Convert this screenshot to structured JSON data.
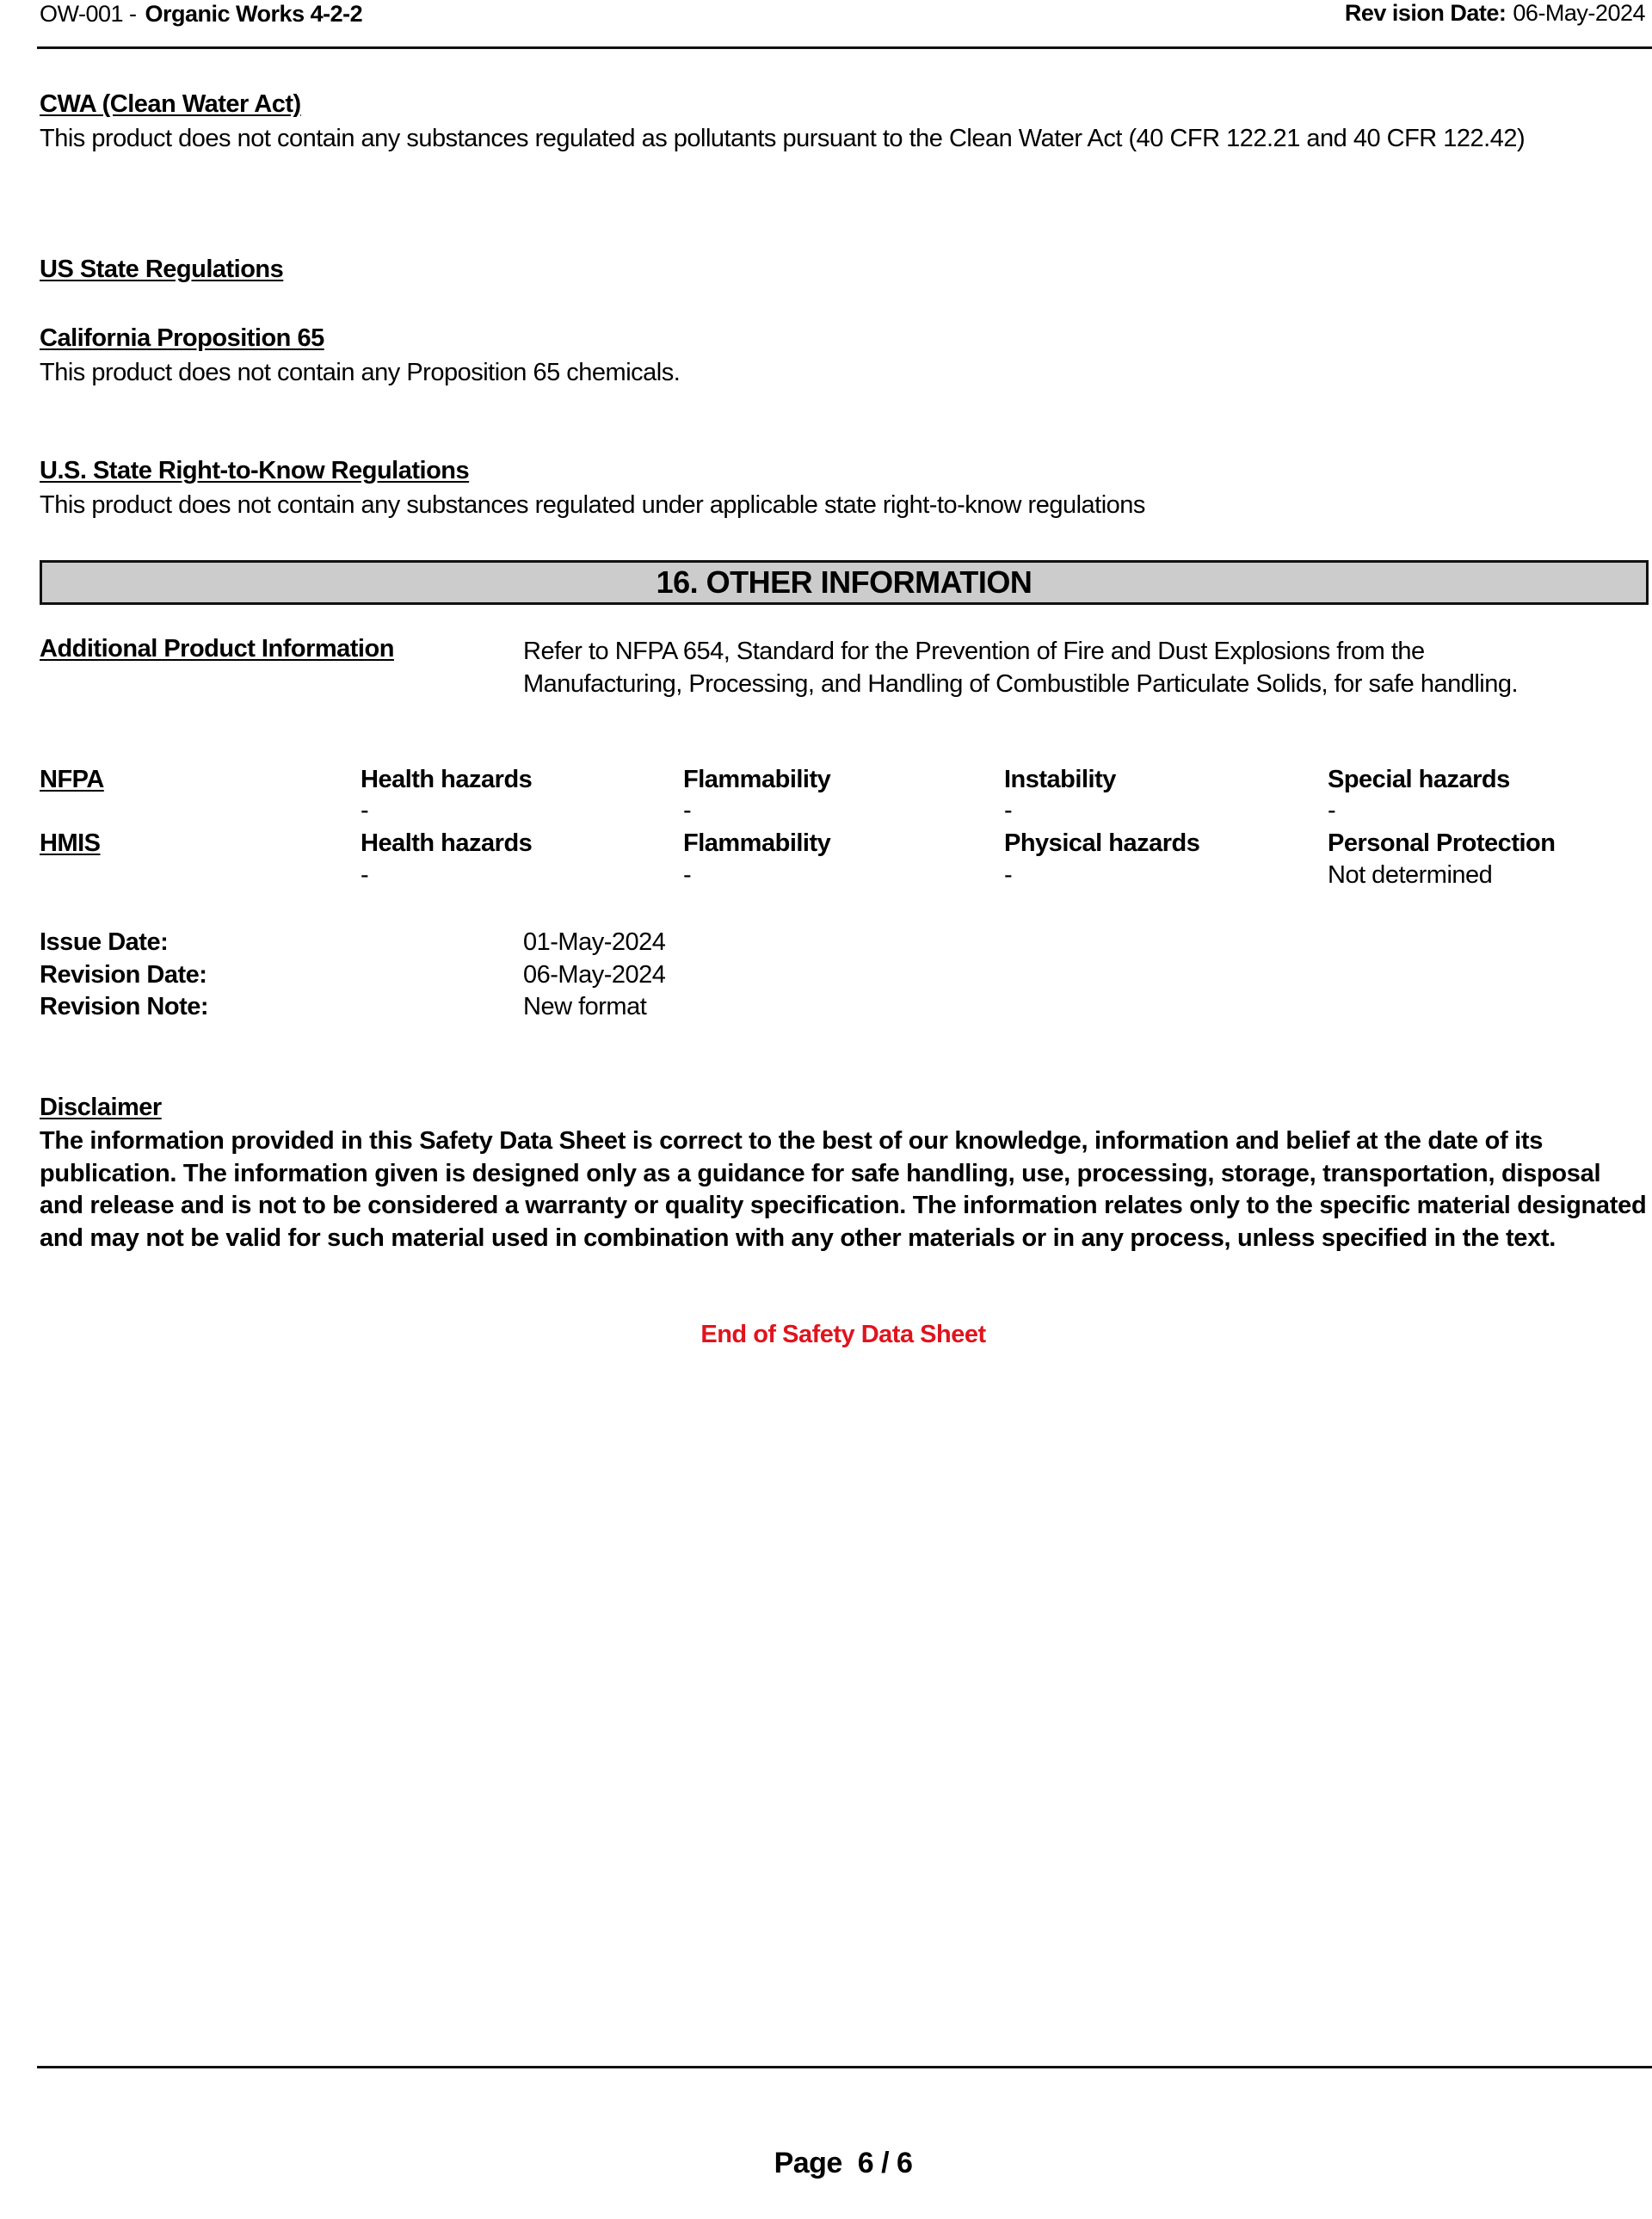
{
  "header": {
    "doc_code": "OW-001 -",
    "product_name": "Organic Works 4-2-2",
    "revision_label": "Rev ision Date:",
    "revision_value": "06-May-2024"
  },
  "regulations": {
    "cwa": {
      "heading": "CWA (Clean Water Act)",
      "text": "This product does not contain any substances regulated as pollutants pursuant to the Clean Water Act (40 CFR 122.21 and 40 CFR 122.42)"
    },
    "us_state": {
      "heading": "US State Regulations"
    },
    "prop65": {
      "heading": "California Proposition 65",
      "text": "This product does not contain any Proposition 65 chemicals."
    },
    "right_to_know": {
      "heading": "U.S. State Right-to-Know Regulations",
      "text": "This product does not contain any substances regulated under applicable state right-to-know regulations"
    }
  },
  "section16": {
    "title": "16. OTHER INFORMATION",
    "additional_info": {
      "label": "Additional Product Information",
      "text": "Refer to NFPA 654, Standard for the Prevention of Fire and Dust Explosions from the Manufacturing, Processing, and Handling of Combustible Particulate Solids, for safe handling."
    },
    "nfpa": {
      "label": "NFPA",
      "columns": [
        "Health hazards",
        "Flammability",
        "Instability",
        "Special hazards"
      ],
      "values": [
        "-",
        "-",
        "-",
        "-"
      ]
    },
    "hmis": {
      "label": "HMIS",
      "columns": [
        "Health hazards",
        "Flammability",
        "Physical hazards",
        "Personal Protection"
      ],
      "values": [
        "-",
        "-",
        "-",
        "Not determined"
      ]
    },
    "dates": [
      {
        "label": "Issue Date:",
        "value": "01-May-2024"
      },
      {
        "label": "Revision Date:",
        "value": "06-May-2024"
      },
      {
        "label": "Revision Note:",
        "value": "New format"
      }
    ],
    "disclaimer": {
      "heading": "Disclaimer",
      "text": "The information provided in this Safety Data Sheet is correct to the best of our knowledge, information and belief at the date of its publication. The information given is designed only as a guidance for safe handling, use, processing, storage, transportation, disposal and release and is not to be considered a warranty or quality specification. The information relates only to the specific material designated and may not be valid for such material used in combination with any other materials or in any process, unless specified in the text."
    },
    "end_text": "End of Safety Data Sheet"
  },
  "footer": {
    "page_label": "Page  6 / 6"
  },
  "colors": {
    "section_fill": "#cccccc",
    "end_text": "#e0141e",
    "text": "#000000"
  }
}
